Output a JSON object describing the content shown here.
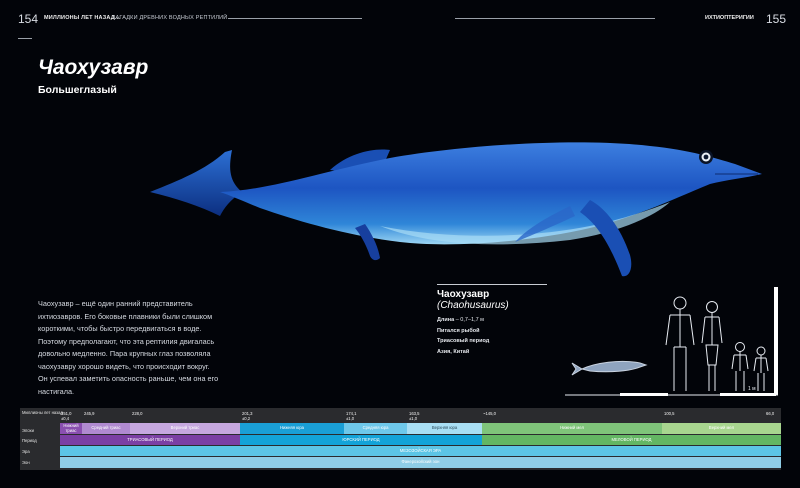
{
  "header": {
    "page_left": "154",
    "running_left_bold": "МИЛЛИОНЫ ЛЕТ НАЗАД...",
    "running_left": "ЗАГАДКИ ДРЕВНИХ ВОДНЫХ РЕПТИЛИЙ",
    "running_right": "ИХТИОПТЕРИГИИ",
    "page_right": "155"
  },
  "title": "Чаохузавр",
  "subtitle": "Большеглазый",
  "body_lines": [
    "Чаохузавр – ещё один ранний представитель",
    "ихтиозавров. Его боковые плавники были слишком",
    "короткими, чтобы быстро передвигаться в воде.",
    "Поэтому предполагают, что эта рептилия двигалась",
    "довольно медленно. Пара крупных глаз позволяла",
    "чаохузавру хорошо видеть, что происходит вокруг.",
    "Он успевал заметить опасность раньше, чем она его",
    "настигала."
  ],
  "facts": {
    "name": "Чаохузавр",
    "latin": "(Chaohusaurus)",
    "length_label": "Длина",
    "length_value": "– 0,7–1,7 м",
    "diet": "Питался рыбой",
    "period": "Триасовый период",
    "location": "Азия, Китай"
  },
  "scale": {
    "label": "1 м"
  },
  "timeline": {
    "row_labels": {
      "mya": "Миллионы лет назад",
      "epochs": "Эпохи",
      "periods": "Период",
      "era": "Эра",
      "eon": "Эон"
    },
    "numbers": [
      {
        "value": "251,0",
        "sub": "±0,4"
      },
      {
        "value": "245,9",
        "sub": ""
      },
      {
        "value": "228,0",
        "sub": ""
      },
      {
        "value": "201,3",
        "sub": "±0,2"
      },
      {
        "value": "174,1",
        "sub": "±1,0"
      },
      {
        "value": "163,5",
        "sub": "±1,0"
      },
      {
        "value": "~145,0",
        "sub": ""
      },
      {
        "value": "100,5",
        "sub": ""
      },
      {
        "value": "66,0",
        "sub": ""
      }
    ],
    "epochs": [
      {
        "label": "Нижний триас",
        "color": "#8a4fb0"
      },
      {
        "label": "Средний триас",
        "color": "#b08ad0"
      },
      {
        "label": "Верхний триас",
        "color": "#c6a8df"
      },
      {
        "label": "Нижняя юра",
        "color": "#1a9fd6"
      },
      {
        "label": "Средняя юра",
        "color": "#6ec8ea"
      },
      {
        "label": "Верхняя юра",
        "color": "#a9dff4"
      },
      {
        "label": "Нижний мел",
        "color": "#7fc47a"
      },
      {
        "label": "Верхний мел",
        "color": "#a8d68f"
      }
    ],
    "periods": [
      {
        "label": "ТРИАСОВЫЙ ПЕРИОД",
        "color": "#7b3fa4"
      },
      {
        "label": "ЮРСКИЙ ПЕРИОД",
        "color": "#13a3d8"
      },
      {
        "label": "МЕЛОВОЙ ПЕРИОД",
        "color": "#63b663"
      }
    ],
    "era": {
      "label": "МЕЗОЗОЙСКАЯ ЭРА",
      "color": "#5cc5e6"
    },
    "eon": {
      "label": "Фанерозойский эон",
      "color": "#8fcde6"
    }
  },
  "colors": {
    "background": "#020409",
    "fish_body": "#1f5fd0",
    "fish_belly": "#9ad4f2"
  }
}
